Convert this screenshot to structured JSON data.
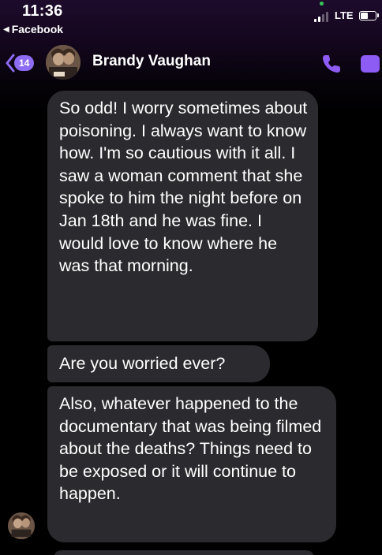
{
  "status_bar": {
    "time": "11:36",
    "back_app_label": "Facebook",
    "network": "LTE",
    "battery_level": 0.45
  },
  "header": {
    "unread_count": "14",
    "contact_name": "Brandy Vaughan",
    "accent_color": "#8d5cf5"
  },
  "messages": [
    {
      "text": "So odd! I worry sometimes about poisoning. I always want to know how. I'm so cautious with it all. I saw a woman comment that she spoke to him the night before on Jan 18th and he was fine. I would love to know where he was that morning."
    },
    {
      "text": "Are you worried ever?"
    },
    {
      "text": "Also, whatever happened to the documentary that was being filmed about the deaths? Things need to be exposed or it will continue to happen."
    }
  ],
  "icons": {
    "back": "chevron-left-icon",
    "call": "phone-icon",
    "video": "video-icon"
  }
}
